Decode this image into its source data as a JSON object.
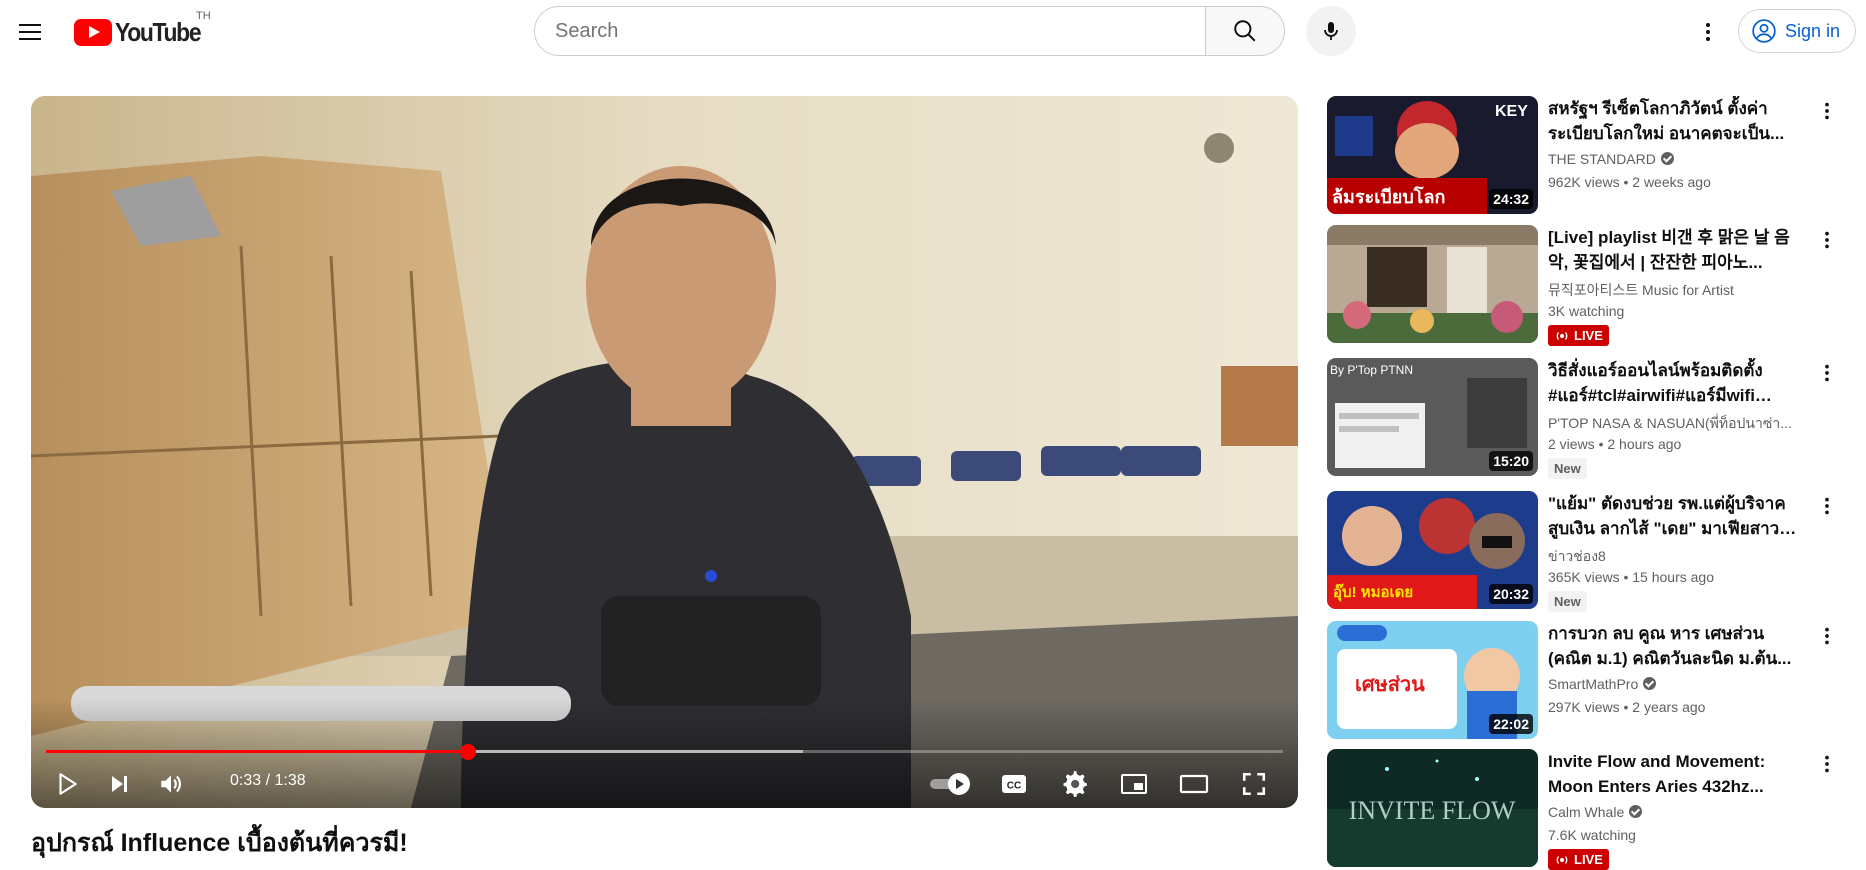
{
  "masthead": {
    "logo_text": "YouTube",
    "country_code": "TH",
    "search_placeholder": "Search",
    "signin_label": "Sign in"
  },
  "player": {
    "current_time": "0:33",
    "duration": "1:38",
    "time_display": "0:33 / 1:38",
    "progress_fraction": 0.341,
    "buffer_fraction": 0.612
  },
  "video": {
    "title": "อุปกรณ์ Influence เบื้องต้นที่ควรมี!"
  },
  "recommendations": [
    {
      "title": "สหรัฐฯ รีเซ็ตโลกาภิวัตน์ ตั้งค่าระเบียบโลกใหม่ อนาคตจะเป็น...",
      "channel": "THE STANDARD",
      "verified": true,
      "meta": "962K views • 2 weeks ago",
      "duration": "24:32",
      "badge": "",
      "thumb_text": "ล้มระเบียบโลก"
    },
    {
      "title": "[Live] playlist 비갠 후 맑은 날 음악, 꽃집에서 | 잔잔한 피아노...",
      "channel": "뮤직포아티스트 Music for Artist",
      "verified": false,
      "meta": "3K watching",
      "duration": "",
      "badge": "LIVE",
      "thumb_text": ""
    },
    {
      "title": "วิธีสั่งแอร์ออนไลน์พร้อมติดตั้ง #แอร์#tcl#airwifi#แอร์มีwifi #แอ...",
      "channel": "P'TOP NASA & NASUAN(พี่ท็อปนาซ่า...",
      "verified": false,
      "meta": "2 views • 2 hours ago",
      "duration": "15:20",
      "badge": "New",
      "thumb_text": "By P'Top PTNN"
    },
    {
      "title": "\"แย้ม\" ตัดงบช่วย รพ.แต่ผู้บริจาคสูบเงิน ลากไส้ \"เดย\" มาเฟียสาว \"วัดไ...",
      "channel": "ข่าวช่อง8",
      "verified": false,
      "meta": "365K views • 15 hours ago",
      "duration": "20:32",
      "badge": "New",
      "thumb_text": "อุ๊บ! หมอเดย"
    },
    {
      "title": "การบวก ลบ คูณ หาร เศษส่วน (คณิต ม.1) คณิตวันละนิด ม.ต้น...",
      "channel": "SmartMathPro",
      "verified": true,
      "meta": "297K views • 2 years ago",
      "duration": "22:02",
      "badge": "",
      "thumb_text": "เศษส่วน"
    },
    {
      "title": "Invite Flow and Movement: Moon Enters Aries 432hz...",
      "channel": "Calm Whale",
      "verified": true,
      "meta": "7.6K watching",
      "duration": "",
      "badge": "LIVE",
      "thumb_text": "INVITE FLOW"
    }
  ],
  "colors": {
    "brand_red": "#ff0000",
    "link_blue": "#065fd4",
    "live_red": "#cc0000"
  },
  "icons": [
    "menu-icon",
    "youtube-logo-icon",
    "search-icon",
    "mic-icon",
    "more-vert-icon",
    "account-circle-icon",
    "play-icon",
    "next-icon",
    "volume-icon",
    "autoplay-toggle-icon",
    "captions-icon",
    "settings-icon",
    "miniplayer-icon",
    "theater-icon",
    "fullscreen-icon",
    "live-icon"
  ]
}
